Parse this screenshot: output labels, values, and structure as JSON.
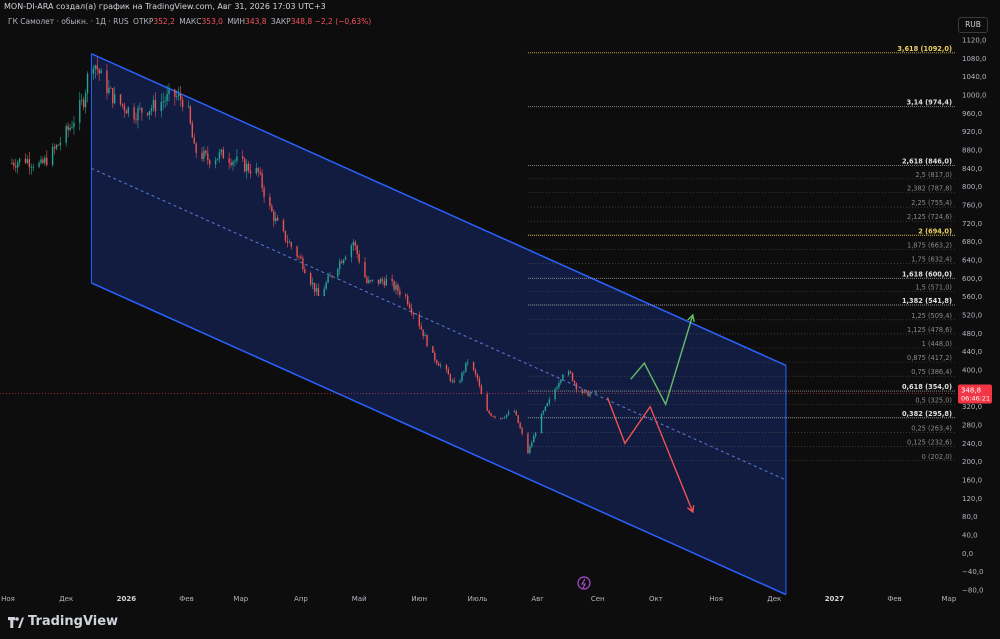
{
  "header": {
    "publisher_line": "MON-DI-ARA создал(а) график на TradingView.com, Авг 31, 2026 17:03 UTC+3",
    "symbol": "ГК Самолет · обыкн. · 1Д · RUS",
    "open_label": "ОТКР",
    "open_value": "352,2",
    "high_label": "МАКС",
    "high_value": "353,0",
    "low_label": "МИН",
    "low_value": "343,8",
    "close_label": "ЗАКР",
    "close_value": "348,8",
    "change": "−2,2 (−0,63%)",
    "currency_button": "RUB"
  },
  "footer": {
    "brand": "TradingView"
  },
  "colors": {
    "bg": "#0d0d0d",
    "up": "#26a69a",
    "down": "#ef5350",
    "channel": "#2962ff",
    "channel_fill": "#14204a",
    "fib_gold": "#f0d264",
    "arrow_up": "#66bb6a",
    "arrow_down": "#ef5350",
    "price_tag": "#f23645"
  },
  "chart_data": {
    "type": "candlestick",
    "ylim": [
      -80,
      1120
    ],
    "y_ticks": [
      "1120,0",
      "1080,0",
      "1040,0",
      "1000,0",
      "960,0",
      "920,0",
      "880,0",
      "840,0",
      "800,0",
      "760,0",
      "720,0",
      "680,0",
      "640,0",
      "600,0",
      "560,0",
      "520,0",
      "480,0",
      "440,0",
      "400,0",
      "360,0",
      "320,0",
      "280,0",
      "240,0",
      "200,0",
      "160,0",
      "120,0",
      "80,0",
      "40,0",
      "0,0",
      "−40,0",
      "−80,0"
    ],
    "y_tick_values": [
      1120,
      1080,
      1040,
      1000,
      960,
      920,
      880,
      840,
      800,
      760,
      720,
      680,
      640,
      600,
      560,
      520,
      480,
      440,
      400,
      360,
      320,
      280,
      240,
      200,
      160,
      120,
      80,
      40,
      0,
      -40,
      -80
    ],
    "x_labels": [
      {
        "label": "Ноя",
        "date": "2025-11-01"
      },
      {
        "label": "Дек",
        "date": "2025-12-01"
      },
      {
        "label": "2026",
        "date": "2026-01-01"
      },
      {
        "label": "Фев",
        "date": "2026-02-01"
      },
      {
        "label": "Мар",
        "date": "2026-03-01"
      },
      {
        "label": "Апр",
        "date": "2026-04-01"
      },
      {
        "label": "Май",
        "date": "2026-05-01"
      },
      {
        "label": "Июн",
        "date": "2026-06-01"
      },
      {
        "label": "Июль",
        "date": "2026-07-01"
      },
      {
        "label": "Авг",
        "date": "2026-08-01"
      },
      {
        "label": "Сен",
        "date": "2026-09-01"
      },
      {
        "label": "Окт",
        "date": "2026-10-01"
      },
      {
        "label": "Ноя",
        "date": "2026-11-01"
      },
      {
        "label": "Дек",
        "date": "2026-12-01"
      },
      {
        "label": "2027",
        "date": "2027-01-01"
      },
      {
        "label": "Фев",
        "date": "2027-02-01"
      },
      {
        "label": "Мар",
        "date": "2027-03-01"
      }
    ],
    "price_path": [
      [
        "2025-11-01",
        850
      ],
      [
        "2025-11-10",
        860
      ],
      [
        "2025-11-18",
        845
      ],
      [
        "2025-11-25",
        880
      ],
      [
        "2025-12-03",
        930
      ],
      [
        "2025-12-10",
        990
      ],
      [
        "2025-12-14",
        1085
      ],
      [
        "2025-12-20",
        1030
      ],
      [
        "2025-12-26",
        990
      ],
      [
        "2026-01-05",
        960
      ],
      [
        "2026-01-15",
        975
      ],
      [
        "2026-01-25",
        1000
      ],
      [
        "2026-02-01",
        985
      ],
      [
        "2026-02-05",
        880
      ],
      [
        "2026-02-12",
        860
      ],
      [
        "2026-02-20",
        870
      ],
      [
        "2026-03-01",
        850
      ],
      [
        "2026-03-10",
        830
      ],
      [
        "2026-03-15",
        760
      ],
      [
        "2026-03-22",
        700
      ],
      [
        "2026-04-01",
        640
      ],
      [
        "2026-04-10",
        560
      ],
      [
        "2026-04-20",
        630
      ],
      [
        "2026-04-28",
        680
      ],
      [
        "2026-05-05",
        590
      ],
      [
        "2026-05-15",
        595
      ],
      [
        "2026-05-25",
        560
      ],
      [
        "2026-06-01",
        500
      ],
      [
        "2026-06-08",
        430
      ],
      [
        "2026-06-15",
        395
      ],
      [
        "2026-06-20",
        360
      ],
      [
        "2026-06-26",
        420
      ],
      [
        "2026-07-01",
        380
      ],
      [
        "2026-07-05",
        310
      ],
      [
        "2026-07-12",
        295
      ],
      [
        "2026-07-20",
        310
      ],
      [
        "2026-07-27",
        220
      ],
      [
        "2026-08-03",
        300
      ],
      [
        "2026-08-08",
        340
      ],
      [
        "2026-08-14",
        395
      ],
      [
        "2026-08-18",
        390
      ],
      [
        "2026-08-22",
        355
      ],
      [
        "2026-08-26",
        348
      ],
      [
        "2026-08-31",
        348.8
      ]
    ],
    "channel": {
      "upper": [
        [
          "2025-12-14",
          1090
        ],
        [
          "2026-12-07",
          410
        ]
      ],
      "lower": [
        [
          "2025-12-14",
          590
        ],
        [
          "2026-12-07",
          -90
        ]
      ],
      "mid": [
        [
          "2025-12-14",
          840
        ],
        [
          "2026-12-07",
          160
        ]
      ]
    },
    "fib_levels": [
      {
        "label": "3,618 (1092,0)",
        "value": 1092,
        "gold": true
      },
      {
        "label": "3,14 (974,4)",
        "value": 974.4,
        "bold": true
      },
      {
        "label": "2,618 (846,0)",
        "value": 846,
        "bold": true
      },
      {
        "label": "2,5 (817,0)",
        "value": 817
      },
      {
        "label": "2,382 (787,8)",
        "value": 787.8
      },
      {
        "label": "2,25 (755,4)",
        "value": 755.4
      },
      {
        "label": "2,125 (724,6)",
        "value": 724.6
      },
      {
        "label": "2 (694,0)",
        "value": 694,
        "gold": true
      },
      {
        "label": "1,875 (663,2)",
        "value": 663.2
      },
      {
        "label": "1,75 (632,4)",
        "value": 632.4
      },
      {
        "label": "1,618 (600,0)",
        "value": 600,
        "bold": true
      },
      {
        "label": "1,5 (571,0)",
        "value": 571
      },
      {
        "label": "1,382 (541,8)",
        "value": 541.8,
        "bold": true
      },
      {
        "label": "1,25 (509,4)",
        "value": 509.4
      },
      {
        "label": "1,125 (478,6)",
        "value": 478.6
      },
      {
        "label": "1 (448,0)",
        "value": 448
      },
      {
        "label": "0,875 (417,2)",
        "value": 417.2
      },
      {
        "label": "0,75 (386,4)",
        "value": 386.4
      },
      {
        "label": "0,618 (354,0)",
        "value": 354,
        "bold": true
      },
      {
        "label": "0,5 (325,0)",
        "value": 325
      },
      {
        "label": "0,382 (295,8)",
        "value": 295.8,
        "bold": true
      },
      {
        "label": "0,25 (263,4)",
        "value": 263.4
      },
      {
        "label": "0,125 (232,6)",
        "value": 232.6
      },
      {
        "label": "0 (202,0)",
        "value": 202
      }
    ],
    "fib_start_date": "2026-07-27",
    "fib_end_date": "2026-12-07",
    "arrow_up": [
      [
        "2026-09-18",
        380
      ],
      [
        "2026-09-25",
        415
      ],
      [
        "2026-10-06",
        325
      ],
      [
        "2026-10-20",
        520
      ]
    ],
    "arrow_down": [
      [
        "2026-09-06",
        340
      ],
      [
        "2026-09-15",
        240
      ],
      [
        "2026-09-28",
        320
      ],
      [
        "2026-10-20",
        90
      ]
    ],
    "current_price": {
      "value": 348.8,
      "label": "348,8",
      "countdown": "06:46:21"
    }
  }
}
